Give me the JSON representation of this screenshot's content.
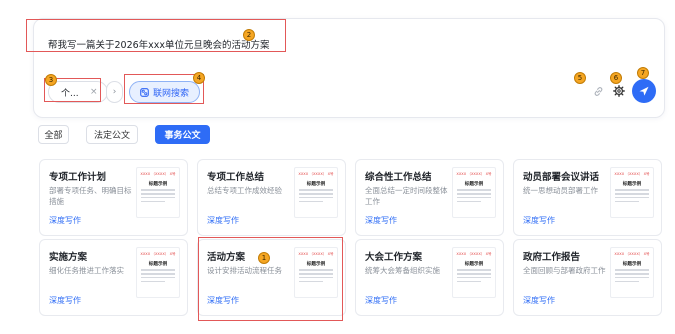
{
  "prompt": {
    "text": "帮我写一篇关于2026年xxx单位元旦晚会的活动方案"
  },
  "chip": {
    "label": "个...",
    "close_glyph": "×",
    "next_glyph": "›"
  },
  "web_search": {
    "label": "联网搜索",
    "icon": "web-search-icon"
  },
  "toolbar": {
    "link_icon": "link-icon",
    "settings_icon": "gear-icon",
    "send_icon": "send-icon"
  },
  "tabs": [
    {
      "label": "全部",
      "active": false
    },
    {
      "label": "法定公文",
      "active": false
    },
    {
      "label": "事务公文",
      "active": true
    }
  ],
  "cards": [
    {
      "title": "专项工作计划",
      "desc": "部署专项任务、明确目标措施",
      "link": "深度写作",
      "thumb_head": "XXXX （XXXX） X号",
      "thumb_title": "标题示例"
    },
    {
      "title": "专项工作总结",
      "desc": "总结专项工作成效经验",
      "link": "深度写作",
      "thumb_head": "XXXX （XXXX） X号",
      "thumb_title": "标题示例"
    },
    {
      "title": "综合性工作总结",
      "desc": "全面总结一定时间段整体工作",
      "link": "深度写作",
      "thumb_head": "XXXX （XXXX） X号",
      "thumb_title": "标题示例"
    },
    {
      "title": "动员部署会议讲话",
      "desc": "统一思想动员部署工作",
      "link": "深度写作",
      "thumb_head": "XXXX （XXXX） X号",
      "thumb_title": "标题示例"
    },
    {
      "title": "实施方案",
      "desc": "细化任务推进工作落实",
      "link": "深度写作",
      "thumb_head": "XXXX （XXXX） X号",
      "thumb_title": "标题示例"
    },
    {
      "title": "活动方案",
      "desc": "设计安排活动流程任务",
      "link": "深度写作",
      "thumb_head": "XXXX （XXXX） X号",
      "thumb_title": "标题示例"
    },
    {
      "title": "大会工作方案",
      "desc": "统筹大会筹备组织实施",
      "link": "深度写作",
      "thumb_head": "XXXX （XXXX） X号",
      "thumb_title": "标题示例"
    },
    {
      "title": "政府工作报告",
      "desc": "全面回顾与部署政府工作",
      "link": "深度写作",
      "thumb_head": "XXXX （XXXX） X号",
      "thumb_title": "标题示例"
    }
  ],
  "markers": [
    "1",
    "2",
    "3",
    "4",
    "5",
    "6",
    "7"
  ],
  "colors": {
    "accent": "#2e6cf6",
    "marker": "#f5a623",
    "highlight": "#e25858"
  }
}
